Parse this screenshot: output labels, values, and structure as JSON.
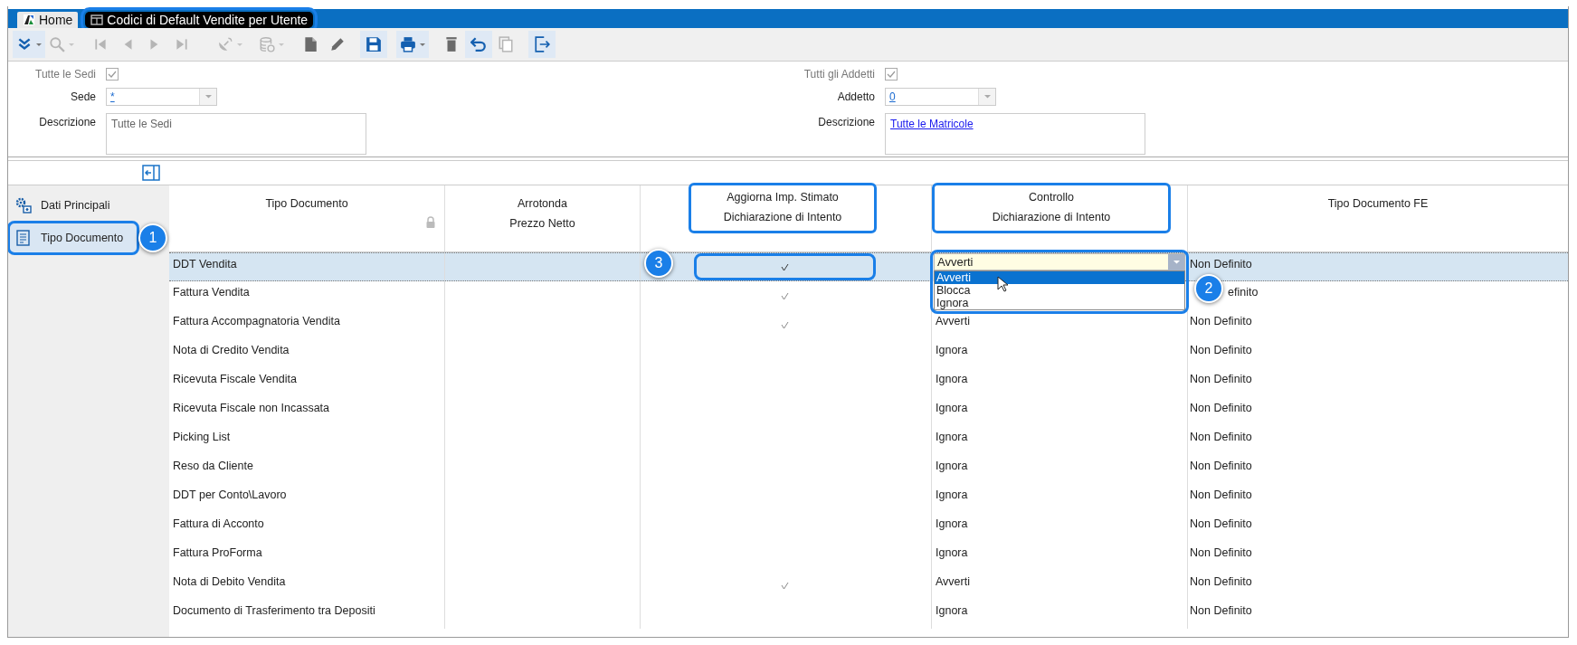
{
  "tabs": [
    {
      "label": "Home",
      "selected": false,
      "highlighted": false
    },
    {
      "label": "Codici di Default Vendite per Utente",
      "selected": true,
      "highlighted": true
    }
  ],
  "toolbar": [
    {
      "disabled": false,
      "active": true,
      "dropdown": true
    },
    {
      "disabled": true,
      "active": false,
      "dropdown": true
    },
    {
      "disabled": true,
      "active": false,
      "dropdown": false
    },
    {
      "disabled": true,
      "active": false,
      "dropdown": false
    },
    {
      "disabled": true,
      "active": false,
      "dropdown": false
    },
    {
      "disabled": true,
      "active": false,
      "dropdown": false
    },
    {
      "disabled": true,
      "active": false,
      "dropdown": true
    },
    {
      "disabled": true,
      "active": false,
      "dropdown": true
    },
    {
      "disabled": false,
      "active": false,
      "dropdown": false
    },
    {
      "disabled": false,
      "active": false,
      "dropdown": false
    },
    {
      "disabled": false,
      "active": true,
      "dropdown": false
    },
    {
      "disabled": false,
      "active": true,
      "dropdown": true
    },
    {
      "disabled": false,
      "active": false,
      "dropdown": false
    },
    {
      "disabled": false,
      "active": true,
      "dropdown": false
    },
    {
      "disabled": true,
      "active": false,
      "dropdown": false
    },
    {
      "disabled": false,
      "active": true,
      "dropdown": false
    }
  ],
  "form": [
    {
      "all_label": "Tutte le Sedi",
      "all_checked": true,
      "code_label": "Sede",
      "code_value": "*",
      "desc_label": "Descrizione",
      "desc_value": "Tutte le Sedi",
      "desc_link": false
    },
    {
      "all_label": "Tutti gli Addetti",
      "all_checked": true,
      "code_label": "Addetto",
      "code_value": "0",
      "desc_label": "Descrizione",
      "desc_value": "Tutte le Matricole",
      "desc_link": true
    }
  ],
  "sidebar": {
    "items": [
      {
        "label": "Dati Principali",
        "selected": false,
        "highlighted": false
      },
      {
        "label": "Tipo Documento",
        "selected": true,
        "highlighted": true,
        "badge": "1"
      }
    ]
  },
  "table": {
    "columns": [
      {
        "label": "Tipo Documento",
        "locked": true,
        "highlighted": false
      },
      {
        "label": "Arrotonda\nPrezzo Netto",
        "locked": false,
        "highlighted": false
      },
      {
        "label": "Aggiorna Imp. Stimato\nDichiarazione di Intento",
        "locked": false,
        "highlighted": true
      },
      {
        "label": "Controllo\nDichiarazione di Intento",
        "locked": false,
        "highlighted": true
      },
      {
        "label": "Tipo Documento FE",
        "locked": false,
        "highlighted": false
      }
    ],
    "rows": [
      {
        "tipo": "DDT Vendita",
        "aggiorna": true,
        "controllo": "Avverti",
        "fe": "Non Definito",
        "selected": true,
        "badge": "3",
        "dropdown": {
          "badge": "2",
          "options": [
            {
              "label": "Avverti",
              "selected": true
            },
            {
              "label": "Blocca",
              "selected": false
            },
            {
              "label": "Ignora",
              "selected": false
            }
          ]
        }
      },
      {
        "tipo": "Fattura Vendita",
        "aggiorna": true,
        "fe": "efinito",
        "selected": false
      },
      {
        "tipo": "Fattura Accompagnatoria Vendita",
        "aggiorna": true,
        "controllo": "Avverti",
        "fe": "Non Definito",
        "selected": false
      },
      {
        "tipo": "Nota di Credito Vendita",
        "aggiorna": false,
        "controllo": "Ignora",
        "fe": "Non Definito",
        "selected": false
      },
      {
        "tipo": "Ricevuta Fiscale Vendita",
        "aggiorna": false,
        "controllo": "Ignora",
        "fe": "Non Definito",
        "selected": false
      },
      {
        "tipo": "Ricevuta Fiscale non Incassata",
        "aggiorna": false,
        "controllo": "Ignora",
        "fe": "Non Definito",
        "selected": false
      },
      {
        "tipo": "Picking List",
        "aggiorna": false,
        "controllo": "Ignora",
        "fe": "Non Definito",
        "selected": false
      },
      {
        "tipo": "Reso da Cliente",
        "aggiorna": false,
        "controllo": "Ignora",
        "fe": "Non Definito",
        "selected": false
      },
      {
        "tipo": "DDT per Conto\\Lavoro",
        "aggiorna": false,
        "controllo": "Ignora",
        "fe": "Non Definito",
        "selected": false
      },
      {
        "tipo": "Fattura di Acconto",
        "aggiorna": false,
        "controllo": "Ignora",
        "fe": "Non Definito",
        "selected": false
      },
      {
        "tipo": "Fattura ProForma",
        "aggiorna": false,
        "controllo": "Ignora",
        "fe": "Non Definito",
        "selected": false
      },
      {
        "tipo": "Nota di Debito Vendita",
        "aggiorna": true,
        "controllo": "Avverti",
        "fe": "Non Definito",
        "selected": false
      },
      {
        "tipo": "Documento di Trasferimento tra Depositi",
        "aggiorna": false,
        "controllo": "Ignora",
        "fe": "Non Definito",
        "selected": false
      }
    ]
  }
}
